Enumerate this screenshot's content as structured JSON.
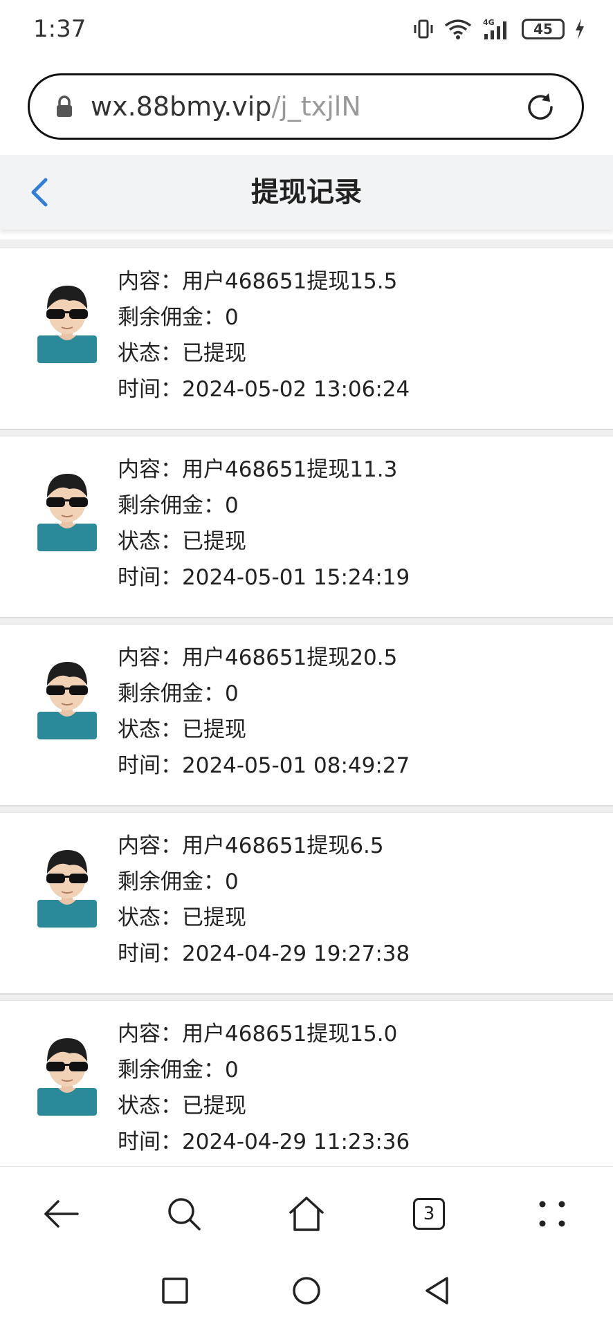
{
  "status_bar": {
    "time": "1:37",
    "battery": "45"
  },
  "browser": {
    "url_host": "wx.88bmy.vip",
    "url_path": "/j_txjlN",
    "tab_count": "3"
  },
  "header": {
    "title": "提现记录"
  },
  "records": [
    {
      "content": "内容：用户468651提现15.5",
      "remaining": "剩余佣金：0",
      "status": "状态：已提现",
      "time": "时间：2024-05-02 13:06:24"
    },
    {
      "content": "内容：用户468651提现11.3",
      "remaining": "剩余佣金：0",
      "status": "状态：已提现",
      "time": "时间：2024-05-01 15:24:19"
    },
    {
      "content": "内容：用户468651提现20.5",
      "remaining": "剩余佣金：0",
      "status": "状态：已提现",
      "time": "时间：2024-05-01 08:49:27"
    },
    {
      "content": "内容：用户468651提现6.5",
      "remaining": "剩余佣金：0",
      "status": "状态：已提现",
      "time": "时间：2024-04-29 19:27:38"
    },
    {
      "content": "内容：用户468651提现15.0",
      "remaining": "剩余佣金：0",
      "status": "状态：已提现",
      "time": "时间：2024-04-29 11:23:36"
    }
  ],
  "colors": {
    "accent_blue": "#2f7fd8",
    "avatar_shirt": "#2a8a99",
    "header_bg": "#f2f3f5"
  }
}
